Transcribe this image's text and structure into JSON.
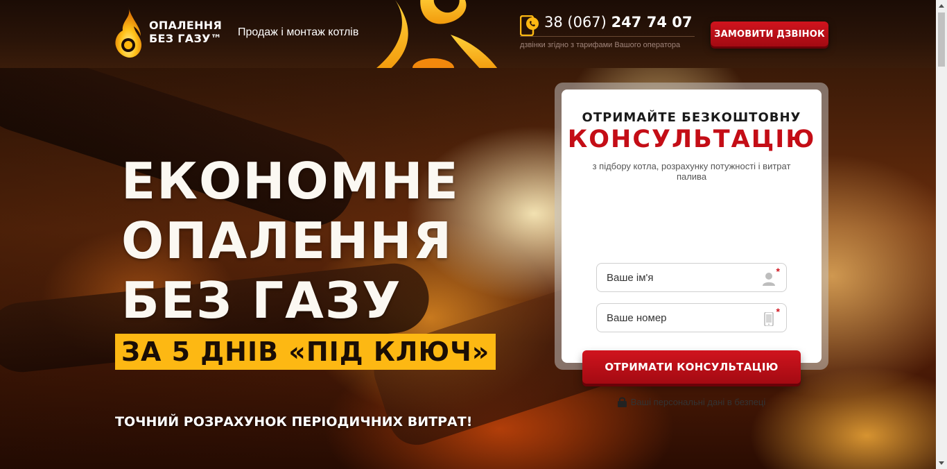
{
  "header": {
    "logo_line1": "ОПАЛЕННЯ",
    "logo_line2": "БЕЗ ГАЗУ™",
    "tagline": "Продаж і монтаж котлів",
    "phone_prefix": "38 (067)",
    "phone_main": "247 74 07",
    "phone_note": "дзвінки згідно з тарифами Вашого оператора",
    "callback_label": "ЗАМОВИТИ ДЗВІНОК"
  },
  "hero": {
    "headline": [
      "ЕКОНОМНЕ",
      "ОПАЛЕННЯ",
      "БЕЗ ГАЗУ"
    ],
    "band": "ЗА 5 ДНІВ «ПІД КЛЮЧ»",
    "subline": "ТОЧНИЙ РОЗРАХУНОК ПЕРІОДИЧНИХ ВИТРАТ!"
  },
  "form": {
    "title1": "ОТРИМАЙТЕ БЕЗКОШТОВНУ",
    "title2": "КОНСУЛЬТАЦІЮ",
    "description": "з підбору котла, розрахунку потужності і витрат палива",
    "name_placeholder": "Ваше ім'я",
    "phone_placeholder": "Ваше номер",
    "required_mark": "*",
    "submit_label": "ОТРИМАТИ КОНСУЛЬТАЦІЮ",
    "privacy_text": "Ваші персональні дані в безпеці"
  },
  "icons": {
    "logo": "flame-logo-icon",
    "phone": "phone-icon",
    "user": "user-icon",
    "mobile": "mobile-icon",
    "lock": "lock-icon"
  },
  "colors": {
    "accent_red": "#c40d16",
    "accent_yellow": "#fdb813"
  }
}
